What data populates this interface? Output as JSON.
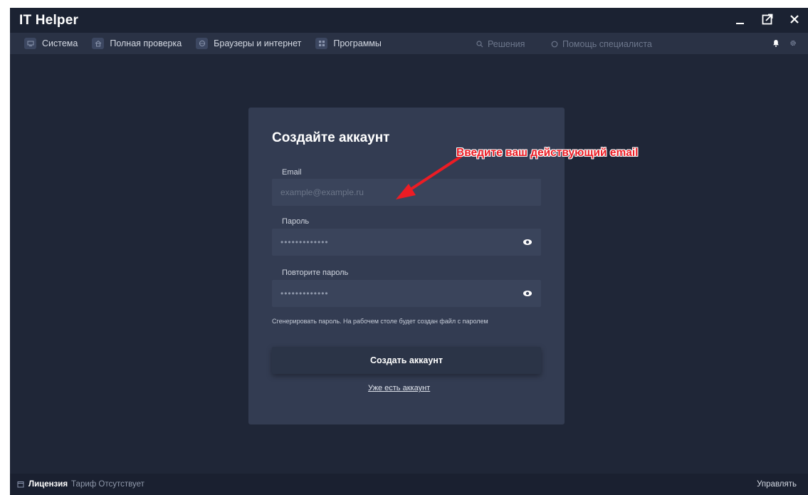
{
  "app": {
    "title": "IT Helper"
  },
  "window_controls": {
    "minimize_icon": "minimize-icon",
    "expand_icon": "expand-icon",
    "close_icon": "close-icon"
  },
  "nav": {
    "items": [
      {
        "label": "Система",
        "icon": "monitor-icon"
      },
      {
        "label": "Полная проверка",
        "icon": "home-icon"
      },
      {
        "label": "Браузеры и интернет",
        "icon": "globe-icon"
      },
      {
        "label": "Программы",
        "icon": "apps-icon"
      }
    ],
    "search_solutions": "Решения",
    "specialist_help": "Помощь специалиста",
    "right_icons": [
      "bell-icon",
      "gear-icon"
    ]
  },
  "form": {
    "title": "Создайте аккаунт",
    "email_label": "Email",
    "email_placeholder": "example@example.ru",
    "password_label": "Пароль",
    "password_value": "•••••••••••••",
    "repeat_label": "Повторите пароль",
    "repeat_value": "•••••••••••••",
    "hint": "Сгенерировать пароль. На рабочем столе будет создан файл с паролем",
    "submit_label": "Создать аккаунт",
    "login_link": "Уже есть аккаунт"
  },
  "annotation": {
    "text": "Введите ваш действующий email",
    "color": "#ec1c24"
  },
  "status": {
    "license_label": "Лицензия",
    "tariff_text": "Тариф Отсутствует",
    "manage_label": "Управлять"
  },
  "colors": {
    "background": "#1f2637",
    "card": "#333c52",
    "field": "#3a445b",
    "navbar": "#2a3245"
  }
}
